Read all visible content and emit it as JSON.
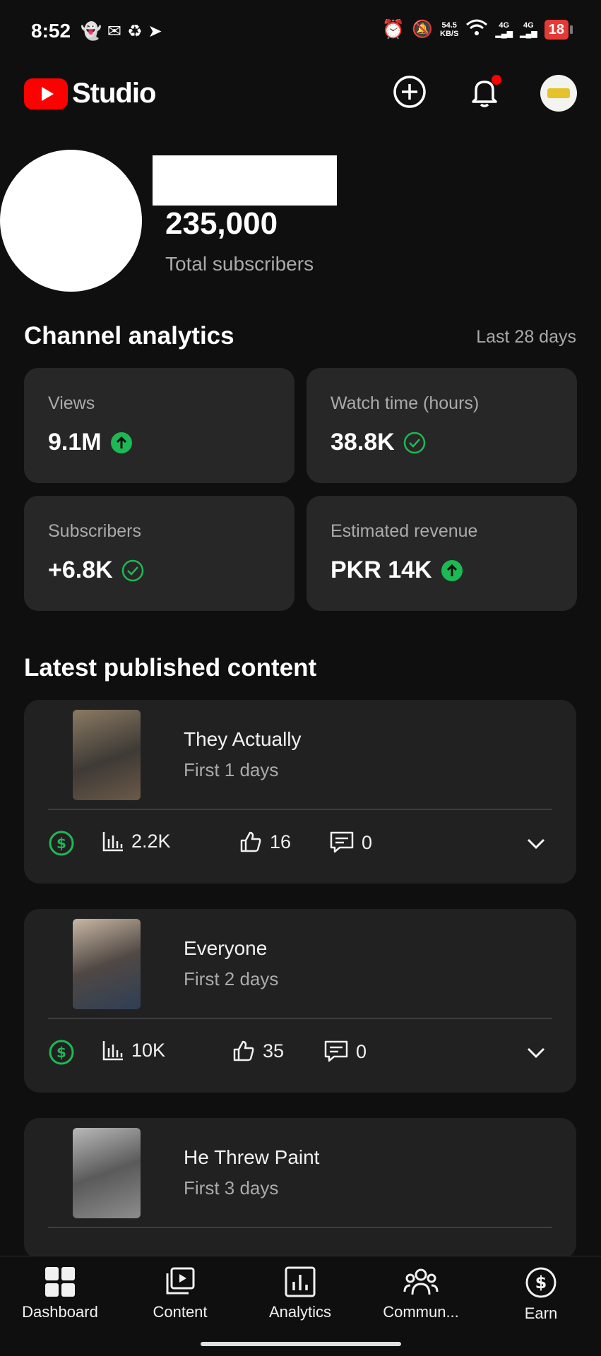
{
  "status_bar": {
    "time": "8:52",
    "net_speed_value": "54.5",
    "net_speed_unit": "KB/S",
    "net1": "4G",
    "net2": "4G",
    "battery": "18"
  },
  "header": {
    "logo_text": "Studio"
  },
  "channel": {
    "subscribers": "235,000",
    "subscribers_label": "Total subscribers"
  },
  "analytics": {
    "title": "Channel analytics",
    "range": "Last 28 days",
    "cards": [
      {
        "label": "Views",
        "value": "9.1M",
        "indicator": "up"
      },
      {
        "label": "Watch time (hours)",
        "value": "38.8K",
        "indicator": "check"
      },
      {
        "label": "Subscribers",
        "value": "+6.8K",
        "indicator": "check"
      },
      {
        "label": "Estimated revenue",
        "value": "PKR 14K",
        "indicator": "up"
      }
    ]
  },
  "latest": {
    "title": "Latest published content",
    "items": [
      {
        "title": "They Actually",
        "subtitle": "First 1 days",
        "views": "2.2K",
        "likes": "16",
        "comments": "0"
      },
      {
        "title": "Everyone",
        "subtitle": "First 2 days",
        "views": "10K",
        "likes": "35",
        "comments": "0"
      },
      {
        "title": "He Threw Paint",
        "subtitle": "First 3 days",
        "views": "",
        "likes": "",
        "comments": ""
      }
    ]
  },
  "bottom_nav": [
    {
      "label": "Dashboard",
      "icon": "dashboard-icon"
    },
    {
      "label": "Content",
      "icon": "content-icon"
    },
    {
      "label": "Analytics",
      "icon": "analytics-icon"
    },
    {
      "label": "Commun...",
      "icon": "community-icon"
    },
    {
      "label": "Earn",
      "icon": "earn-icon"
    }
  ],
  "colors": {
    "background": "#0f0f0f",
    "card": "#272727",
    "accent_green": "#1db954",
    "brand_red": "#ff0000"
  }
}
